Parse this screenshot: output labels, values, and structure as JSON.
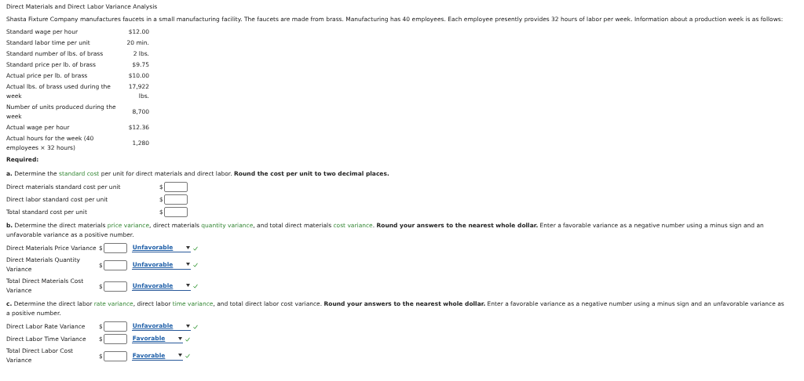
{
  "title": "Direct Materials and Direct Labor Variance Analysis",
  "intro": "Shasta Fixture Company manufactures faucets in a small manufacturing facility. The faucets are made from brass. Manufacturing has 40 employees. Each employee presently provides 32 hours of labor per week. Information about a production week is as follows:",
  "facts": [
    {
      "label": "Standard wage per hour",
      "value": "$12.00"
    },
    {
      "label": "Standard labor time per unit",
      "value": "20 min."
    },
    {
      "label": "Standard number of lbs. of brass",
      "value": "2 lbs."
    },
    {
      "label": "Standard price per lb. of brass",
      "value": "$9.75"
    },
    {
      "label": "Actual price per lb. of brass",
      "value": "$10.00"
    },
    {
      "label": "Actual lbs. of brass used during the week",
      "value": "17,922 lbs."
    },
    {
      "label": "Number of units produced during the week",
      "value": "8,700"
    },
    {
      "label": "Actual wage per hour",
      "value": "$12.36"
    },
    {
      "label": "Actual hours for the week (40 employees × 32 hours)",
      "value": "1,280"
    }
  ],
  "required_label": "Required:",
  "parts": [
    {
      "segments": [
        {
          "kind": "bold",
          "text": "a."
        },
        {
          "kind": "text",
          "text": " Determine the "
        },
        {
          "kind": "term",
          "text": "standard cost"
        },
        {
          "kind": "text",
          "text": " per unit for direct materials and direct labor. "
        },
        {
          "kind": "bold",
          "text": "Round the cost per unit to two decimal places."
        }
      ],
      "rows": [
        {
          "label": "Direct materials standard cost per unit",
          "currency": "$"
        },
        {
          "label": "Direct labor standard cost per unit",
          "currency": "$"
        },
        {
          "label": "Total standard cost per unit",
          "currency": "$"
        }
      ]
    },
    {
      "segments": [
        {
          "kind": "bold",
          "text": "b."
        },
        {
          "kind": "text",
          "text": " Determine the direct materials "
        },
        {
          "kind": "term",
          "text": "price variance"
        },
        {
          "kind": "text",
          "text": ", direct materials "
        },
        {
          "kind": "term",
          "text": "quantity variance"
        },
        {
          "kind": "text",
          "text": ", and total direct materials "
        },
        {
          "kind": "term",
          "text": "cost variance"
        },
        {
          "kind": "text",
          "text": ". "
        },
        {
          "kind": "bold",
          "text": "Round your answers to the nearest whole dollar."
        },
        {
          "kind": "text",
          "text": " Enter a favorable variance as a negative number using a minus sign and an unfavorable variance as a positive number."
        }
      ],
      "rows": [
        {
          "label": "Direct Materials Price Variance",
          "currency": "$",
          "choice": "Unfavorable",
          "correct": true
        },
        {
          "label": "Direct Materials Quantity Variance",
          "currency": "$",
          "choice": "Unfavorable",
          "correct": true
        },
        {
          "label": "Total Direct Materials Cost Variance",
          "currency": "$",
          "choice": "Unfavorable",
          "correct": true
        }
      ]
    },
    {
      "segments": [
        {
          "kind": "bold",
          "text": "c."
        },
        {
          "kind": "text",
          "text": " Determine the direct labor "
        },
        {
          "kind": "term",
          "text": "rate variance"
        },
        {
          "kind": "text",
          "text": ", direct labor "
        },
        {
          "kind": "term",
          "text": "time variance"
        },
        {
          "kind": "text",
          "text": ", and total direct labor cost variance. "
        },
        {
          "kind": "bold",
          "text": "Round your answers to the nearest whole dollar."
        },
        {
          "kind": "text",
          "text": " Enter a favorable variance as a negative number using a minus sign and an unfavorable variance as a positive number."
        }
      ],
      "rows": [
        {
          "label": "Direct Labor Rate Variance",
          "currency": "$",
          "choice": "Unfavorable",
          "correct": true
        },
        {
          "label": "Direct Labor Time Variance",
          "currency": "$",
          "choice": "Favorable",
          "correct": true
        },
        {
          "label": "Total Direct Labor Cost Variance",
          "currency": "$",
          "choice": "Favorable",
          "correct": true
        }
      ]
    }
  ]
}
